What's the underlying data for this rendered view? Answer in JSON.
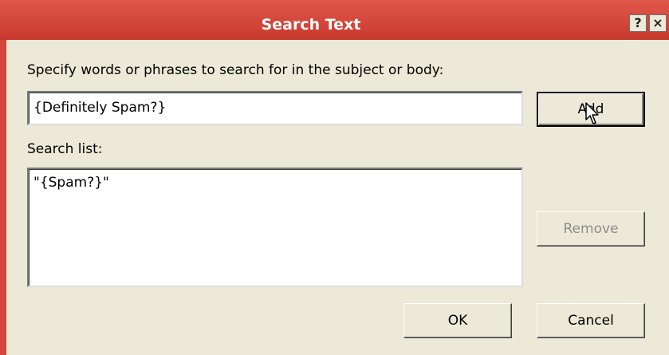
{
  "window": {
    "title": "Search Text",
    "help_label": "?",
    "close_label": "×"
  },
  "dialog": {
    "instructions": "Specify words or phrases to search for in the subject or body:",
    "search_input_value": "{Definitely Spam?}",
    "search_list_label": "Search list:",
    "search_list": [
      "\"{Spam?}\""
    ]
  },
  "buttons": {
    "add": "Add",
    "remove": "Remove",
    "ok": "OK",
    "cancel": "Cancel"
  },
  "colors": {
    "titlebar": "#d5473a",
    "dialog_bg": "#ece9d8",
    "disabled_text": "#8c8c8c"
  },
  "icons": {
    "cursor": "mouse-pointer-icon"
  }
}
